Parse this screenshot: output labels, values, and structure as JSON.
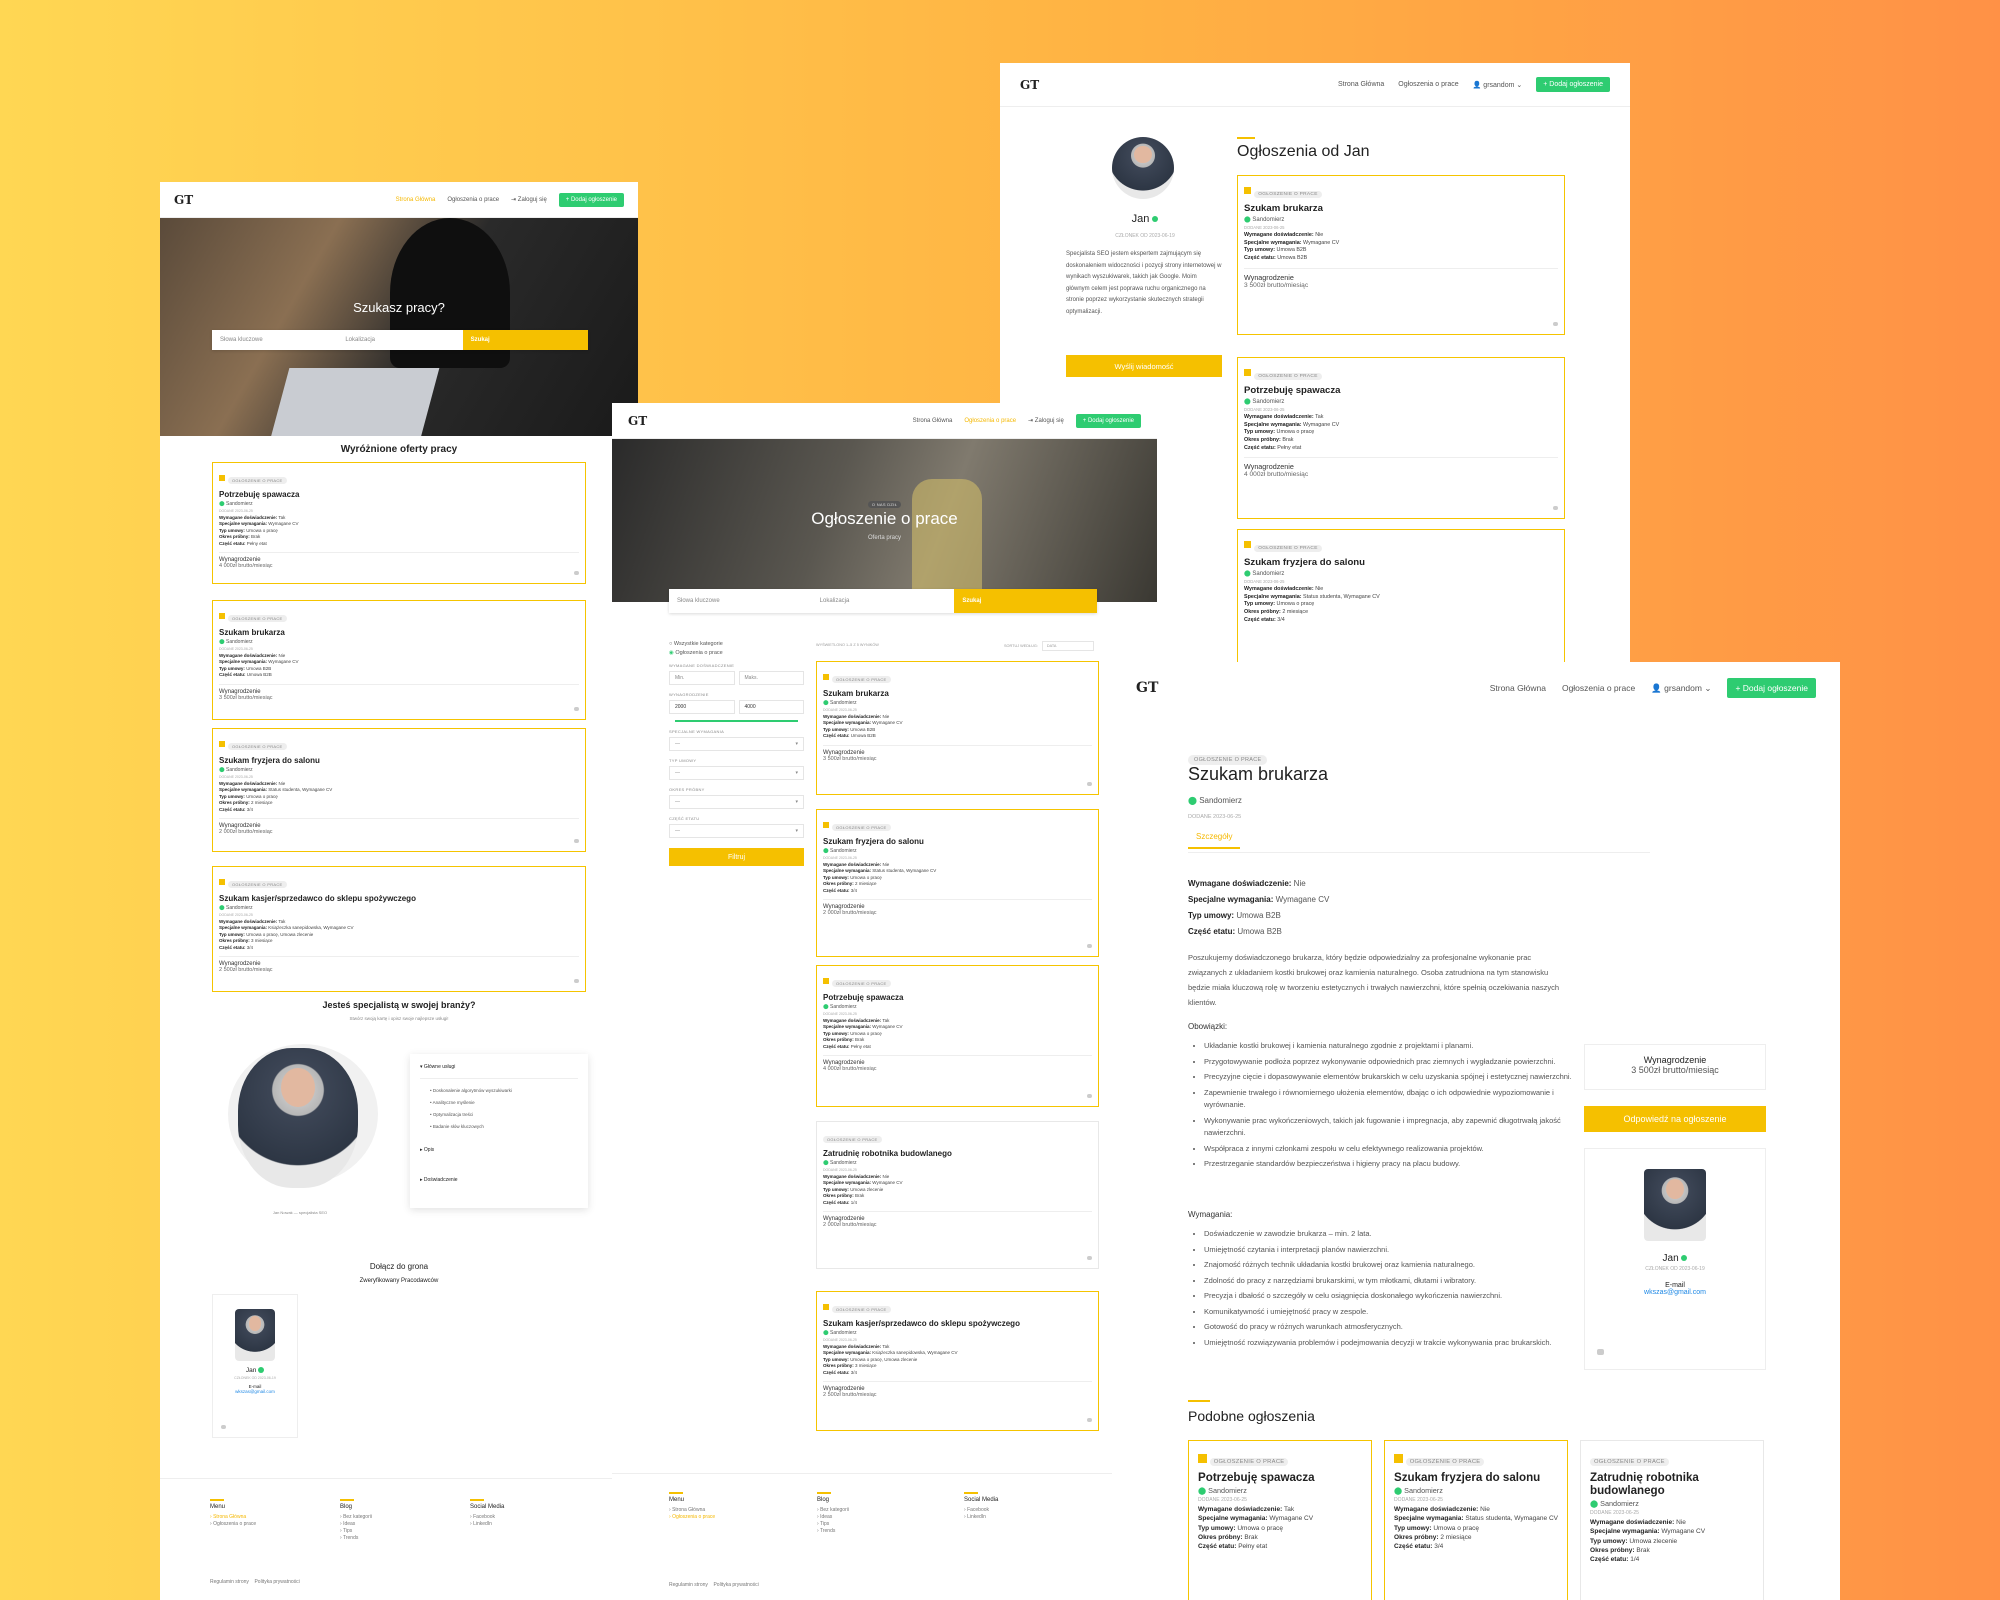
{
  "brand": {
    "logo": "GT",
    "accent": "#f5c000",
    "green": "#2ecc71"
  },
  "nav": {
    "home": "Strona Główna",
    "offers": "Ogłoszenia o prace",
    "login": "Zaloguj się",
    "user": "grsandom",
    "add": "Dodaj ogłoszenie"
  },
  "s1": {
    "hero_title": "Szukasz pracy?",
    "search": {
      "keywords": "Słowa kluczowe",
      "location": "Lokalizacja",
      "button": "Szukaj"
    },
    "featured_title": "Wyróżnione oferty pracy",
    "cards": [
      {
        "badge": "OGŁOSZENIE O PRACE",
        "title": "Potrzebuję spawacza",
        "loc": "Sandomierz",
        "date": "DODANE 2023-06-25",
        "rows": [
          [
            "Wymagane doświadczenie:",
            "Tak"
          ],
          [
            "Specjalne wymagania:",
            "Wymagane CV"
          ],
          [
            "Typ umowy:",
            "Umowa o pracę"
          ],
          [
            "Okres próbny:",
            "Brak"
          ],
          [
            "Część etatu:",
            "Pełny etat"
          ]
        ],
        "salary_label": "Wynagrodzenie",
        "salary": "4 000zł brutto/miesiąc"
      },
      {
        "badge": "OGŁOSZENIE O PRACE",
        "title": "Szukam brukarza",
        "loc": "Sandomierz",
        "date": "DODANE 2023-06-25",
        "rows": [
          [
            "Wymagane doświadczenie:",
            "Nie"
          ],
          [
            "Specjalne wymagania:",
            "Wymagane CV"
          ],
          [
            "Typ umowy:",
            "Umowa B2B"
          ],
          [
            "Część etatu:",
            "Umowa B2B"
          ]
        ],
        "salary_label": "Wynagrodzenie",
        "salary": "3 500zł brutto/miesiąc"
      },
      {
        "badge": "OGŁOSZENIE O PRACE",
        "title": "Szukam fryzjera do salonu",
        "loc": "Sandomierz",
        "date": "DODANE 2023-06-25",
        "rows": [
          [
            "Wymagane doświadczenie:",
            "Nie"
          ],
          [
            "Specjalne wymagania:",
            "Status studenta, Wymagane CV"
          ],
          [
            "Typ umowy:",
            "Umowa o pracę"
          ],
          [
            "Okres próbny:",
            "2 miesiące"
          ],
          [
            "Część etatu:",
            "3/4"
          ]
        ],
        "salary_label": "Wynagrodzenie",
        "salary": "2 000zł brutto/miesiąc"
      },
      {
        "badge": "OGŁOSZENIE O PRACE",
        "title": "Szukam kasjer/sprzedawco do sklepu spożywczego",
        "loc": "Sandomierz",
        "date": "DODANE 2023-06-25",
        "rows": [
          [
            "Wymagane doświadczenie:",
            "Tak"
          ],
          [
            "Specjalne wymagania:",
            "Książeczka sanepidowska, Wymagane CV"
          ],
          [
            "Typ umowy:",
            "Umowa o pracę, Umowa zlecenie"
          ],
          [
            "Okres próbny:",
            "3 miesiące"
          ],
          [
            "Część etatu:",
            "3/4"
          ]
        ],
        "salary_label": "Wynagrodzenie",
        "salary": "2 500zł brutto/miesiąc"
      }
    ],
    "specialist_title": "Jesteś specjalistą w swojej branży?",
    "specialist_sub": "Stwórz swoją kartę i opisz swoje najlepsze usługi!",
    "accordion": {
      "main": "Główne usługi",
      "items": [
        "Doskonalenie algorytmów wyszukiwarki",
        "Analityczne myślenie",
        "Optymalizacja treści",
        "Badanie słów kluczowych"
      ],
      "opis": "Opis",
      "exp": "Doświadczenie"
    },
    "person_caption": "Jan Nowak — specjalista SEO",
    "join_title": "Dołącz do grona",
    "join_sub": "Zweryfikowany Pracodawców",
    "profile": {
      "name": "Jan",
      "since": "CZŁONEK OD 2023-06-19",
      "email_label": "E-mail",
      "email": "wkszas@gmail.com"
    },
    "footer": {
      "menu": "Menu",
      "menu_items": [
        "Strona Główna",
        "Ogłoszenia o prace"
      ],
      "blog": "Blog",
      "blog_items": [
        "Bez kategorii",
        "Ideas",
        "Tips",
        "Trends"
      ],
      "social": "Social Media",
      "social_items": [
        "Facebook",
        "LinkedIn"
      ],
      "legal": [
        "Regulamin strony",
        "Polityka prywatności"
      ]
    }
  },
  "s2": {
    "badge": "O NAS DZIŁ",
    "title": "Ogłoszenie o prace",
    "sub": "Oferta pracy",
    "search": {
      "keywords": "Słowa kluczowe",
      "location": "Lokalizacja",
      "button": "Szukaj"
    },
    "filters": {
      "all": "Wszystkie kategorie",
      "job": "Ogłoszenia o prace",
      "exp_label": "WYMAGANE DOŚWIADCZENIE",
      "min": "Min.",
      "max": "Maks.",
      "salary_label": "WYNAGRODZENIE",
      "sal_min": "2000",
      "sal_max": "4000",
      "req_label": "SPECJALNE WYMAGANIA",
      "type_label": "TYP UMOWY",
      "trial_label": "OKRES PRÓBNY",
      "part_label": "CZĘŚĆ ETATU",
      "dash": "—",
      "button": "Filtruj"
    },
    "results": "WYŚWIETLONO 1–5 Z 5 WYNIKÓW",
    "sort_label": "SORTUJ WEDŁUG:",
    "sort": "DATA",
    "cards": [
      {
        "badge": "OGŁOSZENIE O PRACE",
        "title": "Szukam brukarza",
        "loc": "Sandomierz",
        "date": "DODANE 2023-06-25",
        "rows": [
          [
            "Wymagane doświadczenie:",
            "Nie"
          ],
          [
            "Specjalne wymagania:",
            "Wymagane CV"
          ],
          [
            "Typ umowy:",
            "Umowa B2B"
          ],
          [
            "Część etatu:",
            "Umowa B2B"
          ]
        ],
        "salary_label": "Wynagrodzenie",
        "salary": "3 500zł brutto/miesiąc",
        "featured": true
      },
      {
        "badge": "OGŁOSZENIE O PRACE",
        "title": "Szukam fryzjera do salonu",
        "loc": "Sandomierz",
        "date": "DODANE 2023-06-25",
        "rows": [
          [
            "Wymagane doświadczenie:",
            "Nie"
          ],
          [
            "Specjalne wymagania:",
            "Status studenta, Wymagane CV"
          ],
          [
            "Typ umowy:",
            "Umowa o pracę"
          ],
          [
            "Okres próbny:",
            "2 miesiące"
          ],
          [
            "Część etatu:",
            "3/4"
          ]
        ],
        "salary_label": "Wynagrodzenie",
        "salary": "2 000zł brutto/miesiąc",
        "featured": true
      },
      {
        "badge": "OGŁOSZENIE O PRACE",
        "title": "Potrzebuję spawacza",
        "loc": "Sandomierz",
        "date": "DODANE 2023-06-25",
        "rows": [
          [
            "Wymagane doświadczenie:",
            "Tak"
          ],
          [
            "Specjalne wymagania:",
            "Wymagane CV"
          ],
          [
            "Typ umowy:",
            "Umowa o pracę"
          ],
          [
            "Okres próbny:",
            "Brak"
          ],
          [
            "Część etatu:",
            "Pełny etat"
          ]
        ],
        "salary_label": "Wynagrodzenie",
        "salary": "4 000zł brutto/miesiąc",
        "featured": true
      },
      {
        "badge": "OGŁOSZENIE O PRACE",
        "title": "Zatrudnię robotnika budowlanego",
        "loc": "Sandomierz",
        "date": "DODANE 2023-06-25",
        "rows": [
          [
            "Wymagane doświadczenie:",
            "Nie"
          ],
          [
            "Specjalne wymagania:",
            "Wymagane CV"
          ],
          [
            "Typ umowy:",
            "Umowa zlecenie"
          ],
          [
            "Okres próbny:",
            "Brak"
          ],
          [
            "Część etatu:",
            "1/4"
          ]
        ],
        "salary_label": "Wynagrodzenie",
        "salary": "2 000zł brutto/miesiąc",
        "featured": false
      },
      {
        "badge": "OGŁOSZENIE O PRACE",
        "title": "Szukam kasjer/sprzedawco do sklepu spożywczego",
        "loc": "Sandomierz",
        "date": "DODANE 2023-06-25",
        "rows": [
          [
            "Wymagane doświadczenie:",
            "Tak"
          ],
          [
            "Specjalne wymagania:",
            "Książeczka sanepidowska, Wymagane CV"
          ],
          [
            "Typ umowy:",
            "Umowa o pracę, Umowa zlecenie"
          ],
          [
            "Okres próbny:",
            "3 miesiące"
          ],
          [
            "Część etatu:",
            "3/4"
          ]
        ],
        "salary_label": "Wynagrodzenie",
        "salary": "2 500zł brutto/miesiąc",
        "featured": true
      }
    ],
    "footer": {
      "menu": "Menu",
      "menu_items": [
        "Strona Główna",
        "Ogłoszenia o prace"
      ],
      "blog": "Blog",
      "blog_items": [
        "Bez kategorii",
        "Ideas",
        "Tips",
        "Trends"
      ],
      "social": "Social Media",
      "social_items": [
        "Facebook",
        "LinkedIn"
      ],
      "legal": [
        "Regulamin strony",
        "Polityka prywatności"
      ]
    }
  },
  "s3": {
    "name": "Jan",
    "since": "CZŁONEK OD 2023-06-19",
    "bio": "Specjalista SEO jestem ekspertem zajmującym się doskonaleniem widoczności i pozycji strony internetowej w wynikach wyszukiwarek, takich jak Google. Moim głównym celem jest poprawa ruchu organicznego na stronie poprzez wykorzystanie skutecznych strategii optymalizacji.",
    "button": "Wyślij wiadomość",
    "title": "Ogłoszenia od Jan",
    "cards": [
      {
        "badge": "OGŁOSZENIE O PRACE",
        "title": "Szukam brukarza",
        "loc": "Sandomierz",
        "date": "DODANE 2023-06-25",
        "rows": [
          [
            "Wymagane doświadczenie:",
            "Nie"
          ],
          [
            "Specjalne wymagania:",
            "Wymagane CV"
          ],
          [
            "Typ umowy:",
            "Umowa B2B"
          ],
          [
            "Część etatu:",
            "Umowa B2B"
          ]
        ],
        "salary_label": "Wynagrodzenie",
        "salary": "3 500zł brutto/miesiąc"
      },
      {
        "badge": "OGŁOSZENIE O PRACE",
        "title": "Potrzebuję spawacza",
        "loc": "Sandomierz",
        "date": "DODANE 2023-06-25",
        "rows": [
          [
            "Wymagane doświadczenie:",
            "Tak"
          ],
          [
            "Specjalne wymagania:",
            "Wymagane CV"
          ],
          [
            "Typ umowy:",
            "Umowa o pracę"
          ],
          [
            "Okres próbny:",
            "Brak"
          ],
          [
            "Część etatu:",
            "Pełny etat"
          ]
        ],
        "salary_label": "Wynagrodzenie",
        "salary": "4 000zł brutto/miesiąc"
      },
      {
        "badge": "OGŁOSZENIE O PRACE",
        "title": "Szukam fryzjera do salonu",
        "loc": "Sandomierz",
        "date": "DODANE 2023-06-25",
        "rows": [
          [
            "Wymagane doświadczenie:",
            "Nie"
          ],
          [
            "Specjalne wymagania:",
            "Status studenta, Wymagane CV"
          ],
          [
            "Typ umowy:",
            "Umowa o pracę"
          ],
          [
            "Okres próbny:",
            "2 miesiące"
          ],
          [
            "Część etatu:",
            "3/4"
          ]
        ]
      }
    ]
  },
  "s4": {
    "badge": "OGŁOSZENIE O PRACE",
    "title": "Szukam brukarza",
    "loc": "Sandomierz",
    "date": "DODANE 2023-06-25",
    "tab": "Szczegóły",
    "rows": [
      [
        "Wymagane doświadczenie:",
        "Nie"
      ],
      [
        "Specjalne wymagania:",
        "Wymagane CV"
      ],
      [
        "Typ umowy:",
        "Umowa B2B"
      ],
      [
        "Część etatu:",
        "Umowa B2B"
      ]
    ],
    "desc": "Poszukujemy doświadczonego brukarza, który będzie odpowiedzialny za profesjonalne wykonanie prac związanych z układaniem kostki brukowej oraz kamienia naturalnego. Osoba zatrudniona na tym stanowisku będzie miała kluczową rolę w tworzeniu estetycznych i trwałych nawierzchni, które spełnią oczekiwania naszych klientów.",
    "duties_title": "Obowiązki:",
    "duties": [
      "Układanie kostki brukowej i kamienia naturalnego zgodnie z projektami i planami.",
      "Przygotowywanie podłoża poprzez wykonywanie odpowiednich prac ziemnych i wygładzanie powierzchni.",
      "Precyzyjne cięcie i dopasowywanie elementów brukarskich w celu uzyskania spójnej i estetycznej nawierzchni.",
      "Zapewnienie trwałego i równomiernego ułożenia elementów, dbając o ich odpowiednie wypoziomowanie i wyrównanie.",
      "Wykonywanie prac wykończeniowych, takich jak fugowanie i impregnacja, aby zapewnić długotrwałą jakość nawierzchni.",
      "Współpraca z innymi członkami zespołu w celu efektywnego realizowania projektów.",
      "Przestrzeganie standardów bezpieczeństwa i higieny pracy na placu budowy."
    ],
    "req_title": "Wymagania:",
    "reqs": [
      "Doświadczenie w zawodzie brukarza – min. 2 lata.",
      "Umiejętność czytania i interpretacji planów nawierzchni.",
      "Znajomość różnych technik układania kostki brukowej oraz kamienia naturalnego.",
      "Zdolność do pracy z narzędziami brukarskimi, w tym młotkami, dłutami i wibratory.",
      "Precyzja i dbałość o szczegóły w celu osiągnięcia doskonałego wykończenia nawierzchni.",
      "Komunikatywność i umiejętność pracy w zespole.",
      "Gotowość do pracy w różnych warunkach atmosferycznych.",
      "Umiejętność rozwiązywania problemów i podejmowania decyzji w trakcie wykonywania prac brukarskich."
    ],
    "salary_label": "Wynagrodzenie",
    "salary": "3 500zł brutto/miesiąc",
    "reply": "Odpowiedź na ogłoszenie",
    "profile": {
      "name": "Jan",
      "since": "CZŁONEK OD 2023-06-19",
      "email_label": "E-mail",
      "email": "wkszas@gmail.com"
    },
    "similar_title": "Podobne ogłoszenia",
    "similar": [
      {
        "badge": "OGŁOSZENIE O PRACE",
        "title": "Potrzebuję spawacza",
        "loc": "Sandomierz",
        "date": "DODANE 2023-06-25",
        "rows": [
          [
            "Wymagane doświadczenie:",
            "Tak"
          ],
          [
            "Specjalne wymagania:",
            "Wymagane CV"
          ],
          [
            "Typ umowy:",
            "Umowa o pracę"
          ],
          [
            "Okres próbny:",
            "Brak"
          ],
          [
            "Część etatu:",
            "Pełny etat"
          ]
        ],
        "featured": true
      },
      {
        "badge": "OGŁOSZENIE O PRACE",
        "title": "Szukam fryzjera do salonu",
        "loc": "Sandomierz",
        "date": "DODANE 2023-06-25",
        "rows": [
          [
            "Wymagane doświadczenie:",
            "Nie"
          ],
          [
            "Specjalne wymagania:",
            "Status studenta, Wymagane CV"
          ],
          [
            "Typ umowy:",
            "Umowa o pracę"
          ],
          [
            "Okres próbny:",
            "2 miesiące"
          ],
          [
            "Część etatu:",
            "3/4"
          ]
        ],
        "featured": true
      },
      {
        "badge": "OGŁOSZENIE O PRACE",
        "title": "Zatrudnię robotnika budowlanego",
        "loc": "Sandomierz",
        "date": "DODANE 2023-06-25",
        "rows": [
          [
            "Wymagane doświadczenie:",
            "Nie"
          ],
          [
            "Specjalne wymagania:",
            "Wymagane CV"
          ],
          [
            "Typ umowy:",
            "Umowa zlecenie"
          ],
          [
            "Okres próbny:",
            "Brak"
          ],
          [
            "Część etatu:",
            "1/4"
          ]
        ],
        "featured": false
      }
    ]
  }
}
